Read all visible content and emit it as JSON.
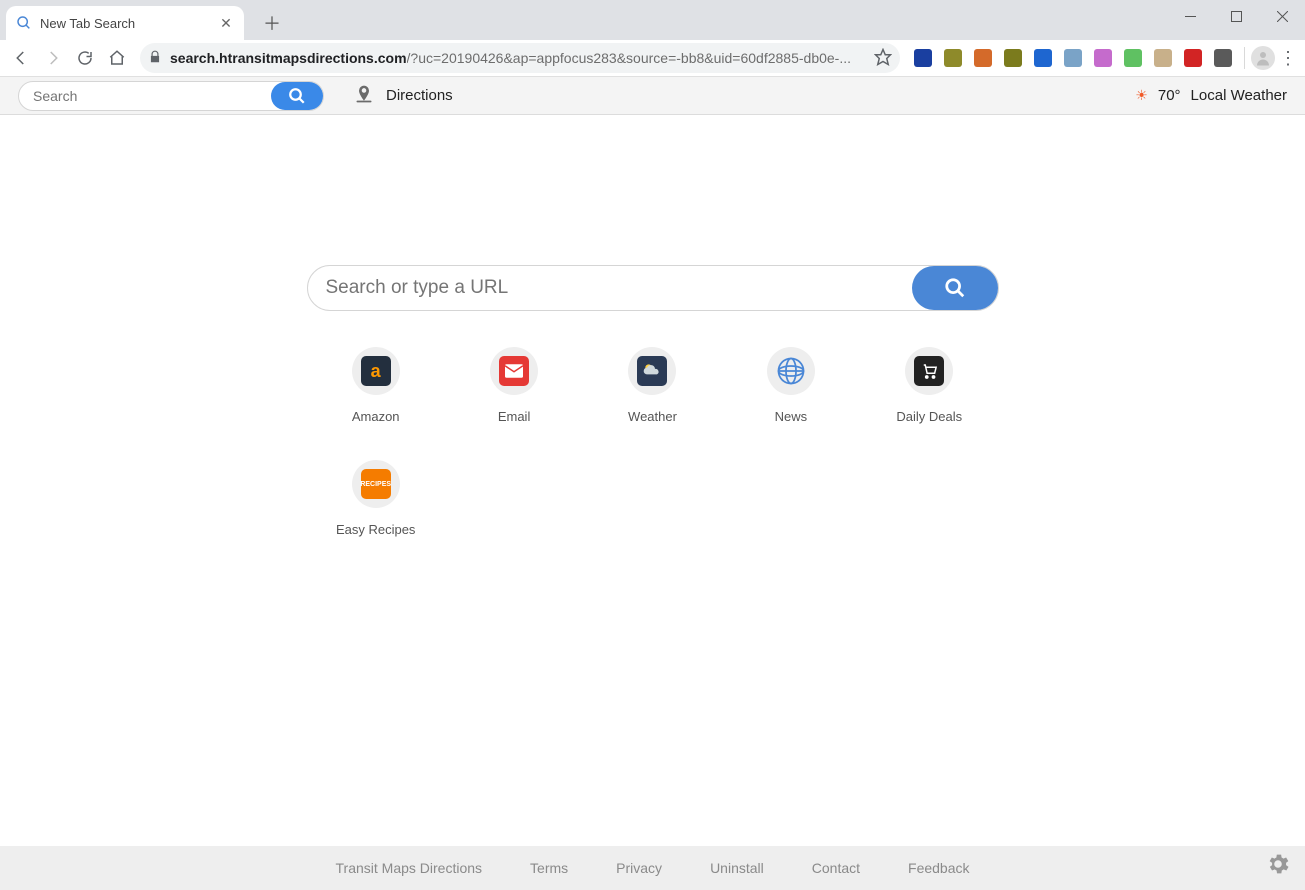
{
  "window": {
    "tab_title": "New Tab Search"
  },
  "toolbar": {
    "url_host": "search.htransitmapsdirections.com",
    "url_rest": "/?uc=20190426&ap=appfocus283&source=-bb8&uid=60df2885-db0e-...",
    "extensions": [
      {
        "name": "ext-eu",
        "color": "#1a3fa0"
      },
      {
        "name": "ext-cc",
        "color": "#8e8a2a"
      },
      {
        "name": "ext-books",
        "color": "#d46a2a"
      },
      {
        "name": "ext-cube",
        "color": "#7b7b1d"
      },
      {
        "name": "ext-a",
        "color": "#1e66d0"
      },
      {
        "name": "ext-tools",
        "color": "#7aa3c7"
      },
      {
        "name": "ext-music",
        "color": "#c56bcc"
      },
      {
        "name": "ext-green",
        "color": "#5fc162"
      },
      {
        "name": "ext-chef",
        "color": "#c8b08a"
      },
      {
        "name": "ext-red",
        "color": "#d22424"
      },
      {
        "name": "ext-camera",
        "color": "#5a5a5a"
      }
    ]
  },
  "extbar": {
    "search_placeholder": "Search",
    "directions_label": "Directions",
    "weather_temp": "70°",
    "weather_label": "Local Weather"
  },
  "main": {
    "search_placeholder": "Search or type a URL",
    "tiles": [
      {
        "id": "amazon",
        "label": "Amazon"
      },
      {
        "id": "email",
        "label": "Email"
      },
      {
        "id": "weather",
        "label": "Weather"
      },
      {
        "id": "news",
        "label": "News"
      },
      {
        "id": "deals",
        "label": "Daily Deals"
      },
      {
        "id": "recipes",
        "label": "Easy Recipes"
      }
    ]
  },
  "footer": {
    "links": [
      "Transit Maps Directions",
      "Terms",
      "Privacy",
      "Uninstall",
      "Contact",
      "Feedback"
    ]
  }
}
